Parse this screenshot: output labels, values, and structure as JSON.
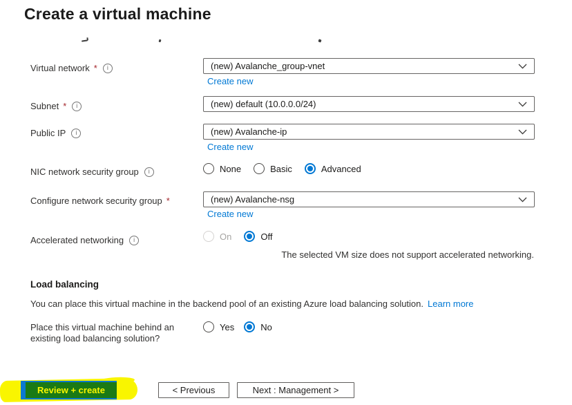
{
  "ui": {
    "required_marker": "*",
    "info_glyph": "i"
  },
  "colors": {
    "accent": "#0078d4",
    "link": "#0078d4",
    "required_asterisk": "#a4262c",
    "highlight_yellow": "#f9f500",
    "highlight_green": "#1a7a15",
    "button_blue": "#0b79d0"
  },
  "header": {
    "title": "Create a virtual machine"
  },
  "form": {
    "virtual_network": {
      "label": "Virtual network",
      "value": "(new) Avalanche_group-vnet",
      "create_new": "Create new"
    },
    "subnet": {
      "label": "Subnet",
      "value": "(new) default (10.0.0.0/24)"
    },
    "public_ip": {
      "label": "Public IP",
      "value": "(new) Avalanche-ip",
      "create_new": "Create new"
    },
    "nic_nsg": {
      "label": "NIC network security group",
      "options": [
        "None",
        "Basic",
        "Advanced"
      ],
      "selected": "Advanced"
    },
    "configure_nsg": {
      "label": "Configure network security group",
      "value": "(new) Avalanche-nsg",
      "create_new": "Create new"
    },
    "accelerated_networking": {
      "label": "Accelerated networking",
      "options": [
        "On",
        "Off"
      ],
      "selected": "Off",
      "disabled_option": "On",
      "note": "The selected VM size does not support accelerated networking."
    }
  },
  "load_balancing": {
    "heading": "Load balancing",
    "description": "You can place this virtual machine in the backend pool of an existing Azure load balancing solution.",
    "learn_more": "Learn more",
    "question": "Place this virtual machine behind an existing load balancing solution?",
    "options": [
      "Yes",
      "No"
    ],
    "selected": "No"
  },
  "footer": {
    "review_create": "Review + create",
    "previous": "< Previous",
    "next": "Next : Management >"
  }
}
